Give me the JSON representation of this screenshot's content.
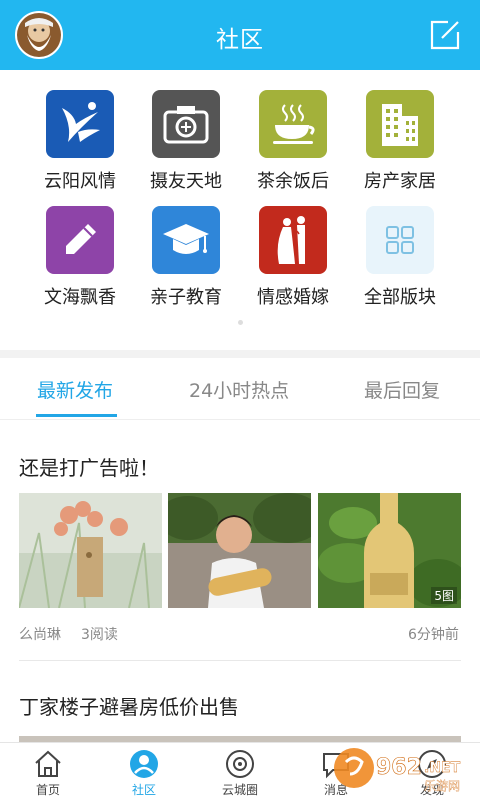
{
  "header": {
    "title": "社区"
  },
  "grid": [
    {
      "label": "云阳风情",
      "icon": "yunyang-logo-icon",
      "color": "#1a5bb5"
    },
    {
      "label": "摄友天地",
      "icon": "camera-icon",
      "color": "#555555"
    },
    {
      "label": "茶余饭后",
      "icon": "tea-cup-icon",
      "color": "#a3b13a"
    },
    {
      "label": "房产家居",
      "icon": "building-icon",
      "color": "#a3b13a"
    },
    {
      "label": "文海飘香",
      "icon": "pencil-icon",
      "color": "#8e44a8"
    },
    {
      "label": "亲子教育",
      "icon": "graduation-cap-icon",
      "color": "#2f86d9"
    },
    {
      "label": "情感婚嫁",
      "icon": "couple-icon",
      "color": "#c22a1d"
    },
    {
      "label": "全部版块",
      "icon": "grid-icon",
      "color": "#e8f4fb"
    }
  ],
  "tabs": [
    {
      "label": "最新发布",
      "active": true
    },
    {
      "label": "24小时热点",
      "active": false
    },
    {
      "label": "最后回复",
      "active": false
    }
  ],
  "posts": [
    {
      "title": "还是打广告啦！",
      "author": "么尚琳",
      "reads": "3阅读",
      "time": "6分钟前",
      "image_count": "5图"
    },
    {
      "title": "丁家楼子避暑房低价出售"
    }
  ],
  "nav": [
    {
      "label": "首页",
      "icon": "home-icon",
      "active": false
    },
    {
      "label": "社区",
      "icon": "community-icon",
      "active": true
    },
    {
      "label": "云城圈",
      "icon": "circle-icon",
      "active": false
    },
    {
      "label": "消息",
      "icon": "message-icon",
      "active": false
    },
    {
      "label": "发现",
      "icon": "discover-icon",
      "active": false
    }
  ],
  "watermark": {
    "text": "962",
    "suffix": ".NET",
    "subtitle": "乐游网"
  },
  "colors": {
    "accent": "#22b7f0",
    "tab_active": "#22a6e6"
  }
}
